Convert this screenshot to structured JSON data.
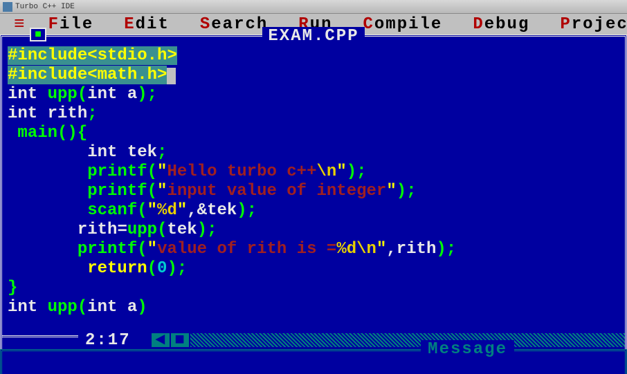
{
  "window": {
    "title": "Turbo C++ IDE"
  },
  "menubar": {
    "items": [
      {
        "hotkey": "F",
        "rest": "ile"
      },
      {
        "hotkey": "E",
        "rest": "dit"
      },
      {
        "hotkey": "S",
        "rest": "earch"
      },
      {
        "hotkey": "R",
        "rest": "un"
      },
      {
        "hotkey": "C",
        "rest": "ompile"
      },
      {
        "hotkey": "D",
        "rest": "ebug"
      },
      {
        "hotkey": "P",
        "rest": "roject"
      }
    ]
  },
  "editor": {
    "title": "EXAM.CPP",
    "cursor_position": "2:17",
    "selected_lines": {
      "l1_a": "#include",
      "l1_b": "<stdio.h>",
      "l2_a": "#include",
      "l2_b": "<math.h>"
    },
    "code": {
      "l3_t1": "int",
      "l3_f": "upp",
      "l3_p1": "(",
      "l3_t2": "int",
      "l3_v": " a",
      "l3_p2": ");",
      "l4_t": "int",
      "l4_v": " rith",
      "l4_p": ";",
      "l5_f": " main",
      "l5_p": "(){",
      "l6_pad": "        ",
      "l6_t": "int",
      "l6_v": " tek",
      "l6_p": ";",
      "l7_pad": "        ",
      "l7_f": "printf",
      "l7_p1": "(",
      "l7_q1": "\"",
      "l7_s": "Hello turbo c++",
      "l7_e": "\\n",
      "l7_q2": "\"",
      "l7_p2": ");",
      "l8_pad": "        ",
      "l8_f": "printf",
      "l8_p1": "(",
      "l8_q1": "\"",
      "l8_s": "input value of integer",
      "l8_q2": "\"",
      "l8_p2": ");",
      "l9_pad": "        ",
      "l9_f": "scanf",
      "l9_p1": "(",
      "l9_q1": "\"",
      "l9_e": "%d",
      "l9_q2": "\"",
      "l9_c": ",",
      "l9_a": "&tek",
      "l9_p2": ");",
      "l10_pad": "       ",
      "l10_v1": "rith",
      "l10_eq": "=",
      "l10_f": "upp",
      "l10_p1": "(",
      "l10_v2": "tek",
      "l10_p2": ");",
      "l11_pad": "       ",
      "l11_f": "printf",
      "l11_p1": "(",
      "l11_q1": "\"",
      "l11_s": "value of rith is =",
      "l11_e1": "%d",
      "l11_e2": "\\n",
      "l11_q2": "\"",
      "l11_c": ",",
      "l11_v": "rith",
      "l11_p2": ");",
      "l12_pad": "        ",
      "l12_k": "return",
      "l12_p1": "(",
      "l12_n": "0",
      "l12_p2": ");",
      "l13": "}",
      "l14_t1": "int",
      "l14_f": "upp",
      "l14_p1": "(",
      "l14_t2": "int",
      "l14_v": " a",
      "l14_p2": ")"
    }
  },
  "message_panel": {
    "title": "Message"
  }
}
